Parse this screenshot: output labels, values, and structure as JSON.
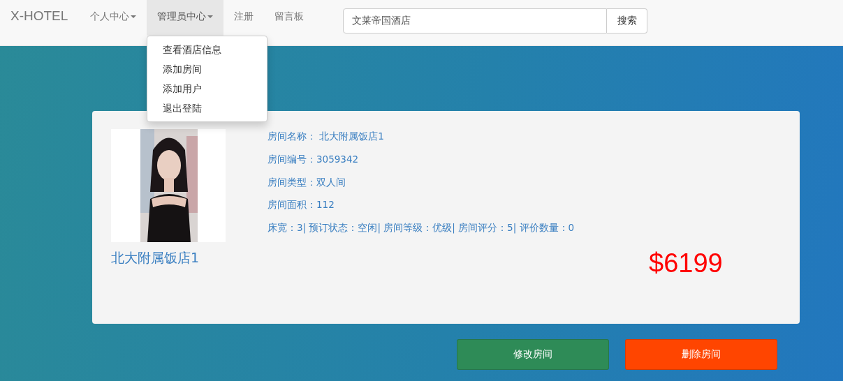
{
  "navbar": {
    "brand": "X-HOTEL",
    "menu": [
      {
        "label": "个人中心",
        "dropdown": true,
        "selected": false
      },
      {
        "label": "管理员中心",
        "dropdown": true,
        "selected": true
      },
      {
        "label": "注册",
        "dropdown": false,
        "selected": false
      },
      {
        "label": "留言板",
        "dropdown": false,
        "selected": false
      }
    ],
    "dropdown_menu": [
      "查看酒店信息",
      "添加房间",
      "添加用户",
      "退出登陆"
    ],
    "search": {
      "value": "文莱帝国酒店",
      "button": "搜索"
    }
  },
  "room": {
    "title": "北大附属饭店1",
    "details": [
      "房间名称： 北大附属饭店1",
      "房间编号：3059342",
      "房间类型：双人间",
      "房间面积：112",
      "床宽：3| 预订状态：空闲| 房间等级：优级| 房间评分：5| 评价数量：0"
    ],
    "price": "$6199"
  },
  "buttons": [
    {
      "label": "修改房间",
      "kind": "edit"
    },
    {
      "label": "删除房间",
      "kind": "delete"
    }
  ]
}
